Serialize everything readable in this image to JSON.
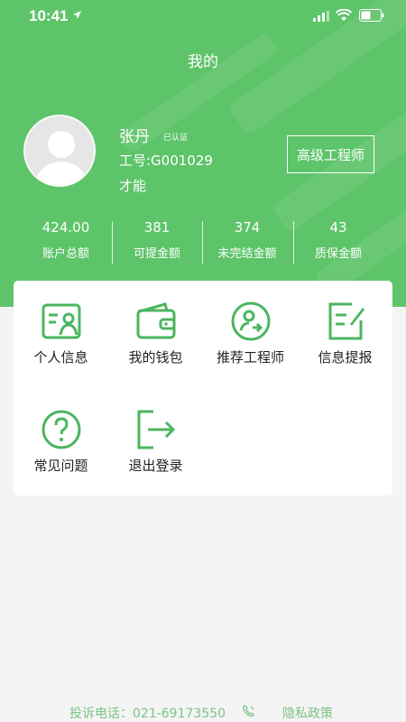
{
  "status_bar": {
    "time": "10:41"
  },
  "nav": {
    "title": "我的"
  },
  "profile": {
    "name": "张丹",
    "verified": "已认证",
    "employee_no": "工号:G001029",
    "talent": "才能",
    "level": "高级工程师"
  },
  "stats": [
    {
      "value": "424.00",
      "label": "账户总额"
    },
    {
      "value": "381",
      "label": "可提金额"
    },
    {
      "value": "374",
      "label": "未完结金额"
    },
    {
      "value": "43",
      "label": "质保金额"
    }
  ],
  "menu": [
    {
      "label": "个人信息",
      "icon": "id-card-icon"
    },
    {
      "label": "我的钱包",
      "icon": "wallet-icon"
    },
    {
      "label": "推荐工程师",
      "icon": "user-arrow-icon"
    },
    {
      "label": "信息提报",
      "icon": "edit-document-icon"
    },
    {
      "label": "常见问题",
      "icon": "question-icon"
    },
    {
      "label": "退出登录",
      "icon": "logout-icon"
    }
  ],
  "footer": {
    "phone": "投诉电话：021-69173550",
    "privacy": "隐私政策"
  },
  "colors": {
    "brand_green": "#5ec46a",
    "icon_green": "#4cb560"
  }
}
